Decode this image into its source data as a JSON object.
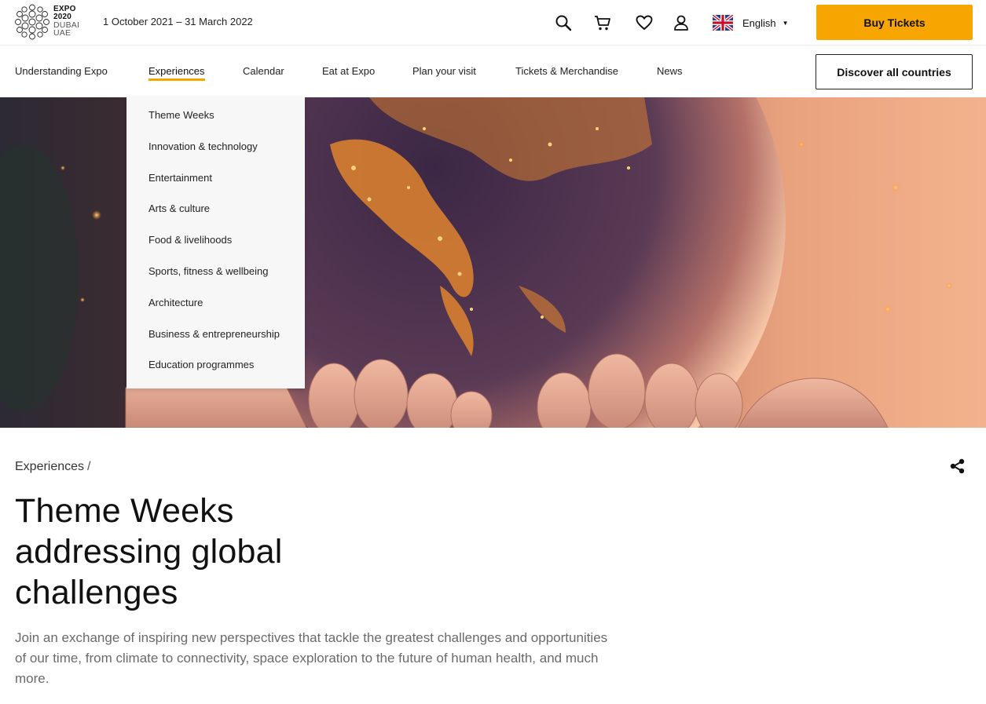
{
  "header": {
    "logo": {
      "line1": "EXPO",
      "line2": "2020",
      "line3": "DUBAI",
      "line4": "UAE"
    },
    "dates": "1 October 2021 – 31 March 2022",
    "icons": [
      "search-icon",
      "cart-icon",
      "heart-icon",
      "user-icon"
    ],
    "language": {
      "label": "English",
      "flag": "uk-flag-icon"
    },
    "buy_tickets": "Buy Tickets"
  },
  "nav": {
    "items": [
      {
        "label": "Understanding Expo"
      },
      {
        "label": "Experiences",
        "active": true
      },
      {
        "label": "Calendar"
      },
      {
        "label": "Eat at Expo"
      },
      {
        "label": "Plan your visit"
      },
      {
        "label": "Tickets & Merchandise"
      },
      {
        "label": "News"
      }
    ],
    "discover_button": "Discover all countries"
  },
  "dropdown": {
    "items": [
      "Theme Weeks",
      "Innovation & technology",
      "Entertainment",
      "Arts & culture",
      "Food & livelihoods",
      "Sports, fitness & wellbeing",
      "Architecture",
      "Business & entrepreneurship",
      "Education programmes"
    ]
  },
  "content": {
    "breadcrumb": "Experiences",
    "breadcrumb_sep": "/",
    "title": "Theme Weeks addressing global challenges",
    "intro": "Join an exchange of inspiring new perspectives that tackle the greatest challenges and opportunities of our time, from climate to connectivity, space exploration to the future of human health, and much more."
  },
  "colors": {
    "accent": "#f7a500",
    "text": "#111111",
    "muted": "#6a6a6a"
  }
}
